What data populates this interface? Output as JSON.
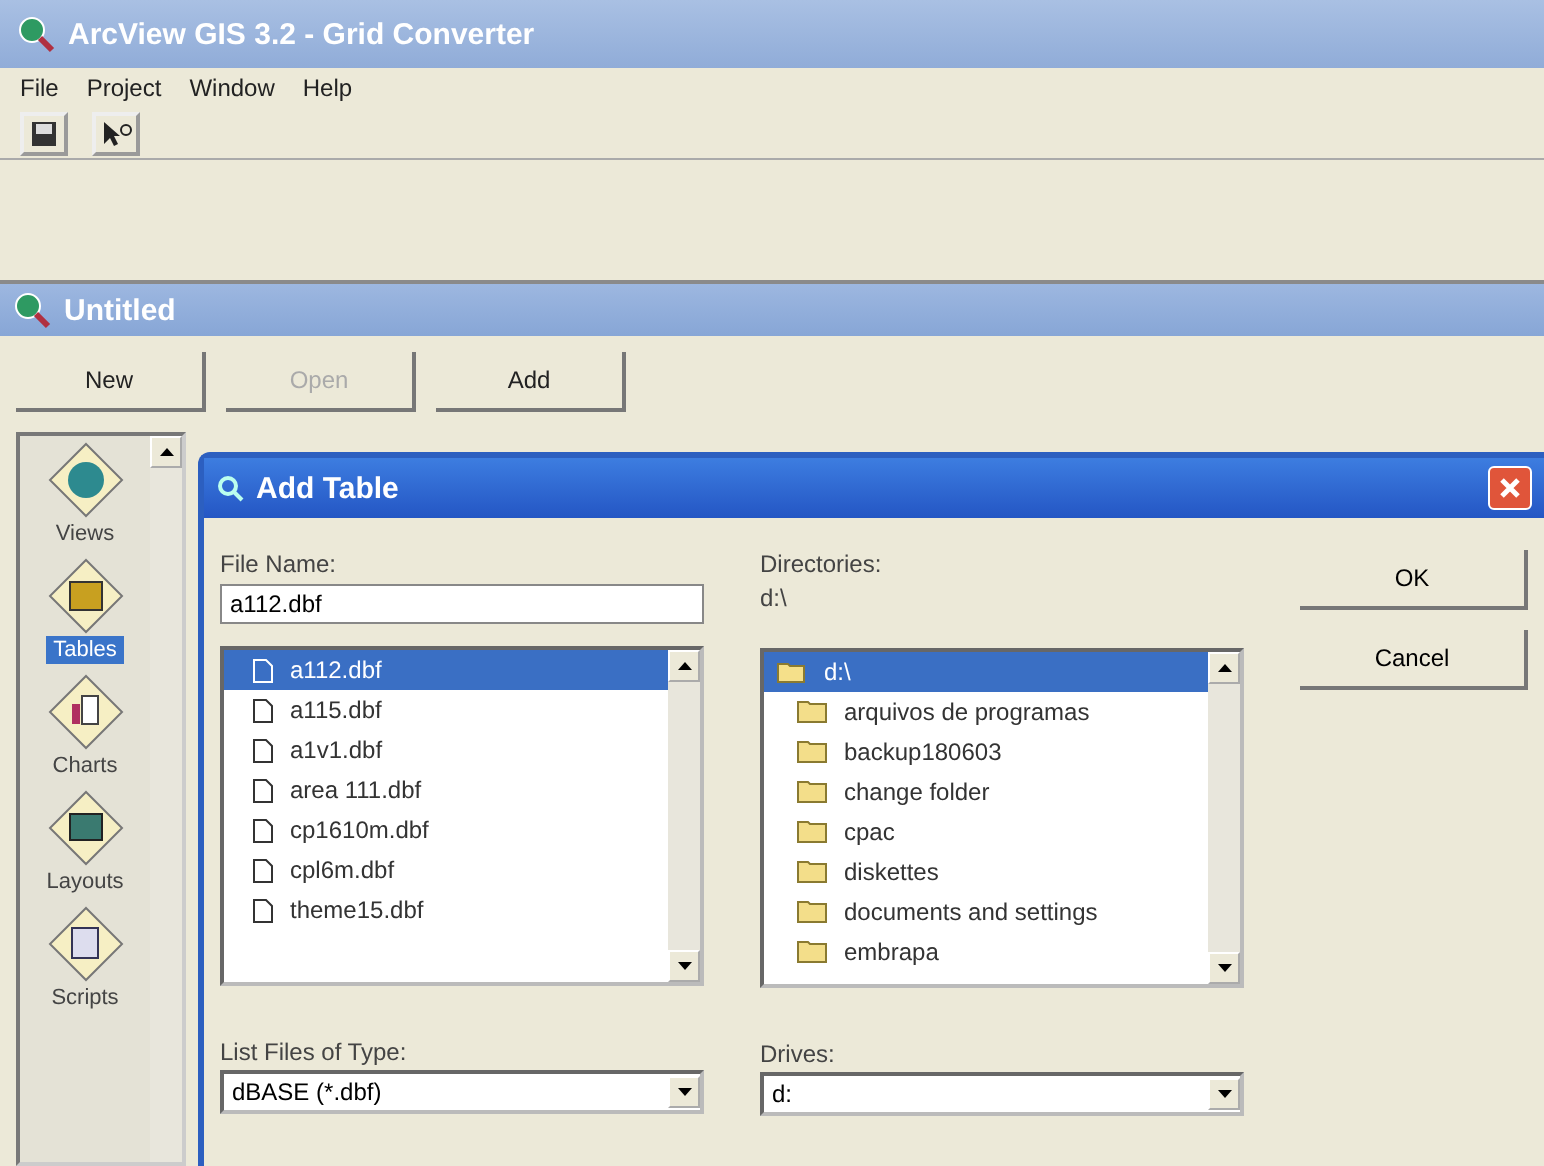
{
  "app_window": {
    "title": "ArcView GIS 3.2 - Grid Converter"
  },
  "menu": [
    "File",
    "Project",
    "Window",
    "Help"
  ],
  "project_window": {
    "title": "Untitled",
    "buttons": [
      {
        "label": "New",
        "disabled": false
      },
      {
        "label": "Open",
        "disabled": true
      },
      {
        "label": "Add",
        "disabled": false
      }
    ],
    "sidebar_items": [
      {
        "label": "Views",
        "kind": "views",
        "selected": false
      },
      {
        "label": "Tables",
        "kind": "tables",
        "selected": true
      },
      {
        "label": "Charts",
        "kind": "charts",
        "selected": false
      },
      {
        "label": "Layouts",
        "kind": "layouts",
        "selected": false
      },
      {
        "label": "Scripts",
        "kind": "scripts",
        "selected": false
      }
    ]
  },
  "dialog": {
    "title": "Add Table",
    "file_name_label": "File Name:",
    "file_name": "a112.dbf",
    "files": [
      {
        "name": "a112.dbf",
        "selected": true
      },
      {
        "name": "a115.dbf",
        "selected": false
      },
      {
        "name": "a1v1.dbf",
        "selected": false
      },
      {
        "name": "area 111.dbf",
        "selected": false
      },
      {
        "name": "cp1610m.dbf",
        "selected": false
      },
      {
        "name": "cpl6m.dbf",
        "selected": false
      },
      {
        "name": "theme15.dbf",
        "selected": false
      }
    ],
    "file_type_label": "List Files of Type:",
    "file_type": "dBASE (*.dbf)",
    "directories_label": "Directories:",
    "current_directory": "d:\\",
    "directories": [
      {
        "name": "d:\\",
        "kind": "open",
        "selected": true
      },
      {
        "name": "arquivos de programas",
        "kind": "closed",
        "selected": false
      },
      {
        "name": "backup180603",
        "kind": "closed",
        "selected": false
      },
      {
        "name": "change folder",
        "kind": "closed",
        "selected": false
      },
      {
        "name": "cpac",
        "kind": "closed",
        "selected": false
      },
      {
        "name": "diskettes",
        "kind": "closed",
        "selected": false
      },
      {
        "name": "documents and settings",
        "kind": "closed",
        "selected": false
      },
      {
        "name": "embrapa",
        "kind": "closed",
        "selected": false
      }
    ],
    "drives_label": "Drives:",
    "drive": "d:",
    "buttons": [
      "OK",
      "Cancel"
    ]
  }
}
